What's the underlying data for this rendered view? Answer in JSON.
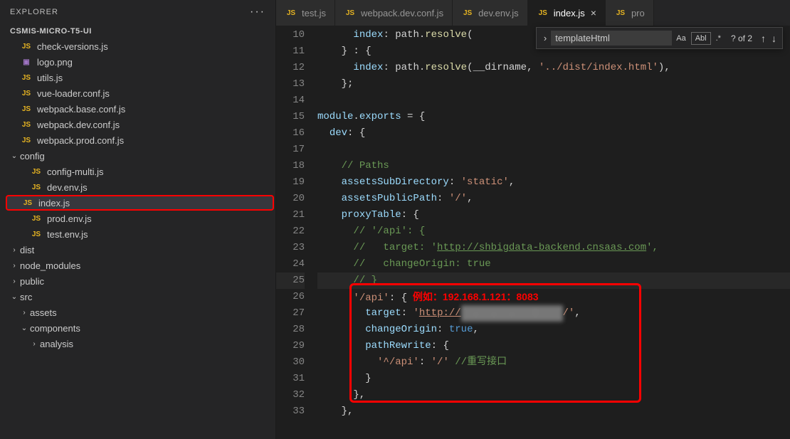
{
  "explorer": {
    "title": "EXPLORER",
    "project": "CSMIS-MICRO-T5-UI"
  },
  "fileTree": [
    {
      "name": "check-versions.js",
      "icon": "JS",
      "iconClass": "js-icon",
      "indent": 0,
      "folder": false
    },
    {
      "name": "logo.png",
      "icon": "▣",
      "iconClass": "img-icon",
      "indent": 0,
      "folder": false
    },
    {
      "name": "utils.js",
      "icon": "JS",
      "iconClass": "js-icon",
      "indent": 0,
      "folder": false
    },
    {
      "name": "vue-loader.conf.js",
      "icon": "JS",
      "iconClass": "js-icon",
      "indent": 0,
      "folder": false
    },
    {
      "name": "webpack.base.conf.js",
      "icon": "JS",
      "iconClass": "js-icon",
      "indent": 0,
      "folder": false
    },
    {
      "name": "webpack.dev.conf.js",
      "icon": "JS",
      "iconClass": "js-icon",
      "indent": 0,
      "folder": false
    },
    {
      "name": "webpack.prod.conf.js",
      "icon": "JS",
      "iconClass": "js-icon",
      "indent": 0,
      "folder": false
    },
    {
      "name": "config",
      "icon": "",
      "iconClass": "",
      "indent": 0,
      "folder": true,
      "open": true
    },
    {
      "name": "config-multi.js",
      "icon": "JS",
      "iconClass": "js-icon",
      "indent": 1,
      "folder": false
    },
    {
      "name": "dev.env.js",
      "icon": "JS",
      "iconClass": "js-icon",
      "indent": 1,
      "folder": false
    },
    {
      "name": "index.js",
      "icon": "JS",
      "iconClass": "js-icon",
      "indent": 1,
      "folder": false,
      "selected": true
    },
    {
      "name": "prod.env.js",
      "icon": "JS",
      "iconClass": "js-icon",
      "indent": 1,
      "folder": false
    },
    {
      "name": "test.env.js",
      "icon": "JS",
      "iconClass": "js-icon",
      "indent": 1,
      "folder": false
    },
    {
      "name": "dist",
      "icon": "",
      "iconClass": "",
      "indent": 0,
      "folder": true,
      "open": false
    },
    {
      "name": "node_modules",
      "icon": "",
      "iconClass": "",
      "indent": 0,
      "folder": true,
      "open": false
    },
    {
      "name": "public",
      "icon": "",
      "iconClass": "",
      "indent": 0,
      "folder": true,
      "open": false
    },
    {
      "name": "src",
      "icon": "",
      "iconClass": "",
      "indent": 0,
      "folder": true,
      "open": true
    },
    {
      "name": "assets",
      "icon": "",
      "iconClass": "",
      "indent": 1,
      "folder": true,
      "open": false
    },
    {
      "name": "components",
      "icon": "",
      "iconClass": "",
      "indent": 1,
      "folder": true,
      "open": true
    },
    {
      "name": "analysis",
      "icon": "",
      "iconClass": "",
      "indent": 2,
      "folder": true,
      "open": false
    }
  ],
  "tabs": [
    {
      "label": "test.js",
      "active": false
    },
    {
      "label": "webpack.dev.conf.js",
      "active": false
    },
    {
      "label": "dev.env.js",
      "active": false
    },
    {
      "label": "index.js",
      "active": true,
      "closable": true
    },
    {
      "label": "pro",
      "active": false
    }
  ],
  "find": {
    "value": "templateHtml",
    "matchCase": "Aa",
    "wholeWord": "Abl",
    "regex": ".*",
    "count": "? of 2",
    "prev": "↑",
    "next": "↓"
  },
  "lineStart": 10,
  "lineEnd": 33,
  "code": {
    "l10": {
      "pre": "      ",
      "a": "index",
      "b": ": path.",
      "c": "resolve",
      "d": "("
    },
    "l11": {
      "pre": "    } : {",
      "t": ""
    },
    "l12": {
      "pre": "      ",
      "a": "index",
      "b": ": path.",
      "c": "resolve",
      "d": "(__dirname, ",
      "e": "'../dist/index.html'",
      "f": "),"
    },
    "l13": {
      "t": "    };"
    },
    "l14": {
      "t": ""
    },
    "l15": {
      "a": "module",
      "b": ".",
      "c": "exports",
      "d": " = {"
    },
    "l16": {
      "pre": "  ",
      "a": "dev",
      "b": ": {"
    },
    "l17": {
      "t": ""
    },
    "l18": {
      "pre": "    ",
      "c": "// Paths"
    },
    "l19": {
      "pre": "    ",
      "a": "assetsSubDirectory",
      "b": ": ",
      "c": "'static'",
      "d": ","
    },
    "l20": {
      "pre": "    ",
      "a": "assetsPublicPath",
      "b": ": ",
      "c": "'/'",
      "d": ","
    },
    "l21": {
      "pre": "    ",
      "a": "proxyTable",
      "b": ": {"
    },
    "l22": {
      "pre": "      ",
      "c": "// '/api': {"
    },
    "l23": {
      "pre": "      ",
      "c": "//   target: '",
      "u": "http://shbigdata-backend.cnsaas.com",
      "c2": "',"
    },
    "l24": {
      "pre": "      ",
      "c": "//   changeOrigin: true"
    },
    "l25": {
      "pre": "      ",
      "c": "// }"
    },
    "l26": {
      "pre": "      ",
      "a": "'/api'",
      "b": ": {",
      "ann": "  例如：192.168.1.121：8083"
    },
    "l27": {
      "pre": "        ",
      "a": "target",
      "b": ": ",
      "c": "'",
      "u": "http://",
      "blur": "  .  .  .   :    ",
      "c2": "/'",
      "d": ","
    },
    "l28": {
      "pre": "        ",
      "a": "changeOrigin",
      "b": ": ",
      "c": "true",
      "d": ","
    },
    "l29": {
      "pre": "        ",
      "a": "pathRewrite",
      "b": ": {"
    },
    "l30": {
      "pre": "          ",
      "a": "'^/api'",
      "b": ": ",
      "c": "'/'",
      "d": " ",
      "cm": "//重写接口"
    },
    "l31": {
      "pre": "        }"
    },
    "l32": {
      "pre": "      },"
    },
    "l33": {
      "pre": "    },"
    }
  }
}
